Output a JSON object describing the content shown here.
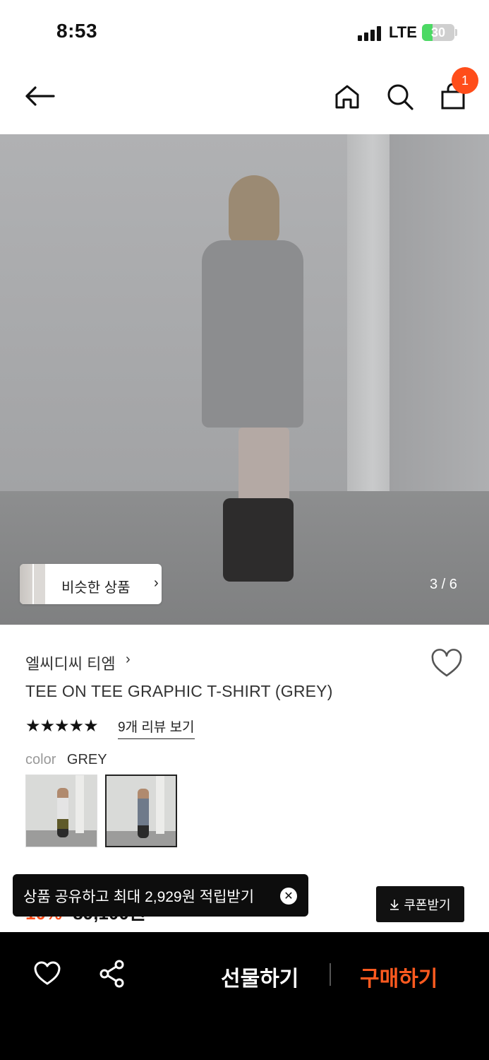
{
  "status_bar": {
    "time": "8:53",
    "network": "LTE",
    "battery": "30"
  },
  "nav": {
    "back_icon": "arrow-left-icon",
    "home_icon": "home-icon",
    "search_icon": "search-icon",
    "cart_icon": "shopping-bag-icon",
    "cart_count": "1",
    "badge_color": "#ff4d1a"
  },
  "gallery": {
    "similar_label": "비슷한 상품",
    "similar_chevron": "›",
    "counter": "3 / 6"
  },
  "product": {
    "brand": "엘씨디씨 티엠",
    "brand_chevron": "›",
    "title": "TEE ON TEE GRAPHIC T-SHIRT (GREY)",
    "rating": 5,
    "stars": "★★★★★",
    "review_link": "9개 리뷰 보기",
    "color_label": "color",
    "color_value": "GREY",
    "swatches": [
      {
        "name": "white-top-variant",
        "selected": false
      },
      {
        "name": "grey-variant",
        "selected": true
      }
    ]
  },
  "price": {
    "discount": "10%",
    "amount": "89,100원"
  },
  "toast": {
    "text": "상품 공유하고 최대 2,929원 적립받기",
    "close": "✕"
  },
  "coupon": {
    "icon": "download-icon",
    "label": "쿠폰받기"
  },
  "bottom_bar": {
    "wish_icon": "heart-icon",
    "share_icon": "share-icon",
    "gift_label": "선물하기",
    "buy_label": "구매하기",
    "buy_color": "#ff5a1f"
  }
}
